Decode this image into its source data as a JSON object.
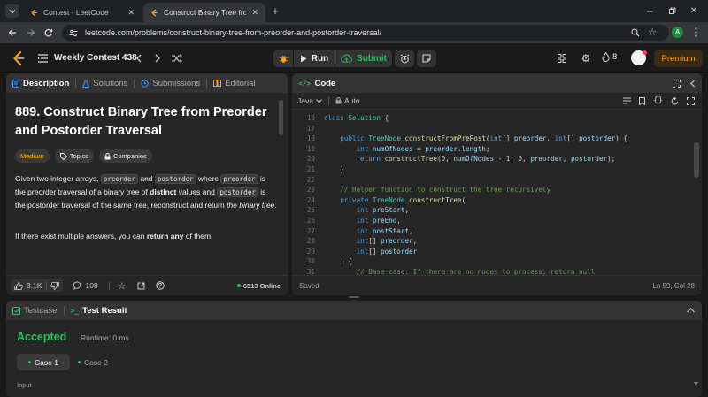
{
  "browser": {
    "tabs": [
      {
        "title": "Contest - LeetCode",
        "active": false
      },
      {
        "title": "Construct Binary Tree from Pre...",
        "active": true
      }
    ],
    "url": "leetcode.com/problems/construct-binary-tree-from-preorder-and-postorder-traversal/",
    "profile_initial": "A"
  },
  "header": {
    "contest": "Weekly Contest 438",
    "run": "Run",
    "submit": "Submit",
    "streak": "8",
    "premium": "Premium"
  },
  "desc": {
    "tabs": [
      "Description",
      "Solutions",
      "Submissions",
      "Editorial"
    ],
    "title": "889. Construct Binary Tree from Preorder and Postorder Traversal",
    "difficulty": "Medium",
    "topics": "Topics",
    "companies": "Companies",
    "p1": {
      "a": "Given two integer arrays, ",
      "code1": "preorder",
      "b": " and ",
      "code2": "postorder",
      "c": " where ",
      "code3": "preorder",
      "d": " is the preorder traversal of a binary tree of ",
      "bold": "distinct",
      "e": " values and ",
      "code4": "postorder",
      "f": " is the postorder traversal of the same tree, reconstruct and return ",
      "ital": "the binary tree",
      "g": "."
    },
    "p2": {
      "a": "If there exist multiple answers, you can ",
      "bold": "return any",
      "b": " of them."
    },
    "likes": "3.1K",
    "comments": "108",
    "online": "6513 Online"
  },
  "code": {
    "title": "Code",
    "language": "Java",
    "mode": "Auto",
    "status": "Saved",
    "position": "Ln 59, Col 28",
    "lines": [
      {
        "n": "16",
        "t": "class Solution {"
      },
      {
        "n": "17",
        "t": ""
      },
      {
        "n": "18",
        "t": "    public TreeNode constructFromPrePost(int[] preorder, int[] postorder) {"
      },
      {
        "n": "19",
        "t": "        int numOfNodes = preorder.length;"
      },
      {
        "n": "20",
        "t": "        return constructTree(0, numOfNodes - 1, 0, preorder, postorder);"
      },
      {
        "n": "21",
        "t": "    }"
      },
      {
        "n": "22",
        "t": ""
      },
      {
        "n": "23",
        "t": "    // Helper function to construct the tree recursively"
      },
      {
        "n": "24",
        "t": "    private TreeNode constructTree("
      },
      {
        "n": "25",
        "t": "        int preStart,"
      },
      {
        "n": "26",
        "t": "        int preEnd,"
      },
      {
        "n": "27",
        "t": "        int postStart,"
      },
      {
        "n": "28",
        "t": "        int[] preorder,"
      },
      {
        "n": "29",
        "t": "        int[] postorder"
      },
      {
        "n": "30",
        "t": "    ) {"
      },
      {
        "n": "31",
        "t": "        // Base case: If there are no nodes to process, return null"
      }
    ]
  },
  "result": {
    "tabs": [
      "Testcase",
      "Test Result"
    ],
    "status": "Accepted",
    "runtime": "Runtime: 0 ms",
    "cases": [
      "Case 1",
      "Case 2"
    ],
    "input_label": "Input"
  },
  "colors": {
    "accent": "#ffa116",
    "accepted": "#2cbb5d",
    "medium": "#ffb800"
  }
}
